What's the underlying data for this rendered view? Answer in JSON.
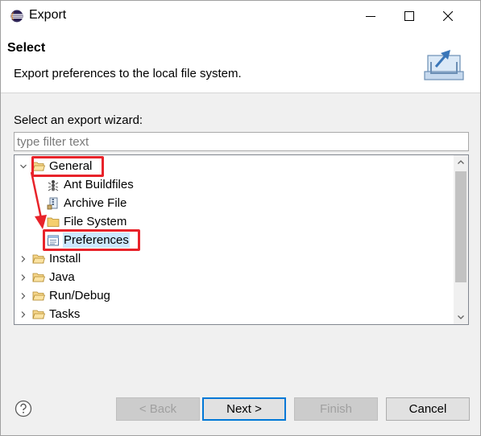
{
  "window": {
    "title": "Export"
  },
  "banner": {
    "title": "Select",
    "description": "Export preferences to the local file system."
  },
  "wizard": {
    "label": "Select an export wizard:",
    "filter_placeholder": "type filter text"
  },
  "tree": {
    "items": [
      {
        "label": "General",
        "icon": "folder-open-icon",
        "expanded": true
      },
      {
        "label": "Ant Buildfiles",
        "icon": "ant-icon"
      },
      {
        "label": "Archive File",
        "icon": "archive-icon"
      },
      {
        "label": "File System",
        "icon": "folder-icon"
      },
      {
        "label": "Preferences",
        "icon": "preferences-icon",
        "selected": true
      },
      {
        "label": "Install",
        "icon": "folder-icon"
      },
      {
        "label": "Java",
        "icon": "folder-icon"
      },
      {
        "label": "Run/Debug",
        "icon": "folder-icon"
      },
      {
        "label": "Tasks",
        "icon": "folder-icon"
      }
    ]
  },
  "buttons": {
    "back": "< Back",
    "next": "Next >",
    "finish": "Finish",
    "cancel": "Cancel"
  },
  "colors": {
    "highlight": "#e8232a",
    "selection": "#cce8ff",
    "default_button_border": "#0078d7"
  }
}
